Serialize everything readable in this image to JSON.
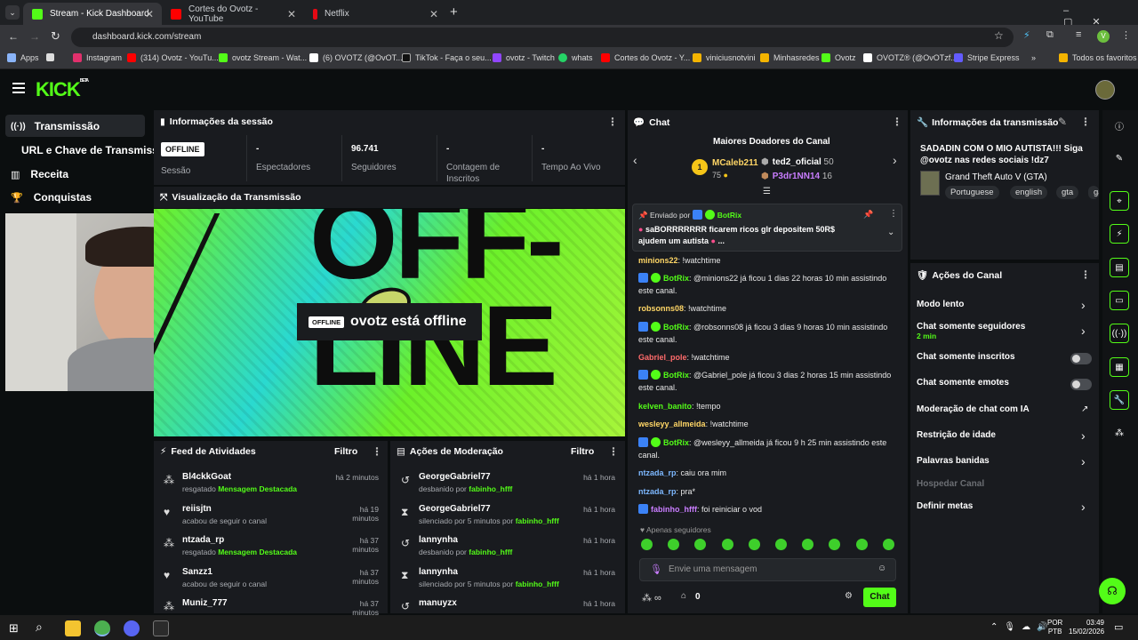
{
  "browser": {
    "tabs": [
      {
        "label": "Stream - Kick Dashboard",
        "active": true
      },
      {
        "label": "Cortes do Ovotz - YouTube",
        "active": false
      },
      {
        "label": "Netflix",
        "active": false
      }
    ],
    "url": "dashboard.kick.com/stream",
    "bookmarks": [
      "Apps",
      "Instagram",
      "(314) Ovotz - YouTu...",
      "ovotz Stream - Wat...",
      "(6) OVOTZ (@OvOT...",
      "TikTok - Faça o seu...",
      "ovotz - Twitch",
      "whats",
      "Cortes do Ovotz - Y...",
      "viniciusnotvini",
      "Minhasredes",
      "Ovotz",
      "OVOTZ® (@OvOTzf...",
      "Stripe Express"
    ],
    "all_favorites": "Todos os favoritos"
  },
  "sidebar": {
    "items": [
      "Transmissão",
      "URL e Chave de Transmissão",
      "Receita",
      "Conquistas"
    ]
  },
  "session": {
    "title": "Informações da sessão",
    "status_badge": "OFFLINE",
    "stats": [
      {
        "value": "",
        "label": "Sessão"
      },
      {
        "value": "-",
        "label": "Espectadores"
      },
      {
        "value": "96.741",
        "label": "Seguidores"
      },
      {
        "value": "-",
        "label": "Contagem de Inscritos"
      },
      {
        "value": "-",
        "label": "Tempo Ao Vivo"
      }
    ]
  },
  "preview": {
    "title": "Visualização da Transmissão",
    "offline_badge": "OFFLINE",
    "offline_text": "ovotz está offline"
  },
  "activity": {
    "title": "Feed de Atividades",
    "filter": "Filtro",
    "rows": [
      {
        "name": "Bl4ckkGoat",
        "sub": "resgatado",
        "hl": "Mensagem Destacada",
        "time": "há 2 minutos",
        "icon": "gift"
      },
      {
        "name": "reiisjtn",
        "sub": "acabou de seguir o canal",
        "hl": "",
        "time": "há 19 minutos",
        "icon": "heart"
      },
      {
        "name": "ntzada_rp",
        "sub": "resgatado",
        "hl": "Mensagem Destacada",
        "time": "há 37 minutos",
        "icon": "gift"
      },
      {
        "name": "Sanzz1",
        "sub": "acabou de seguir o canal",
        "hl": "",
        "time": "há 37 minutos",
        "icon": "heart"
      },
      {
        "name": "Muniz_777",
        "sub": "",
        "hl": "",
        "time": "há 37 minutos",
        "icon": "gift"
      }
    ]
  },
  "moderation": {
    "title": "Ações de Moderação",
    "filter": "Filtro",
    "rows": [
      {
        "name": "GeorgeGabriel77",
        "sub": "desbanido por",
        "by": "fabinho_hfff",
        "time": "há 1 hora",
        "icon": "undo"
      },
      {
        "name": "GeorgeGabriel77",
        "sub": "silenciado por 5 minutos por",
        "by": "fabinho_hfff",
        "time": "há 1 hora",
        "icon": "hourglass"
      },
      {
        "name": "lannynha",
        "sub": "desbanido por",
        "by": "fabinho_hfff",
        "time": "há 1 hora",
        "icon": "undo"
      },
      {
        "name": "lannynha",
        "sub": "silenciado por 5 minutos por",
        "by": "fabinho_hfff",
        "time": "há 1 hora",
        "icon": "hourglass"
      },
      {
        "name": "manuyzx",
        "sub": "",
        "by": "",
        "time": "há 1 hora",
        "icon": "undo"
      }
    ]
  },
  "chat": {
    "title": "Chat",
    "donors_title": "Maiores Doadores do Canal",
    "donors": [
      {
        "rank": "1",
        "name": "MCaleb211",
        "amount": "75"
      },
      {
        "name": "ted2_oficial",
        "amount": "50"
      },
      {
        "name": "P3dr1NN14",
        "amount": "16"
      }
    ],
    "pinned": {
      "by": "Enviado por",
      "user": "BotRix",
      "text": "saBORRRRRRR ficarem ricos glr depositem 50R$ ajudem um autista",
      "suffix": "..."
    },
    "messages": [
      {
        "user": "minions22",
        "color": "#ffd666",
        "text": ": !watchtime",
        "badges": false
      },
      {
        "user": "BotRix",
        "color": "#53fc18",
        "text": ": @minions22 já ficou 1 dias 22 horas 10 min assistindo este canal.",
        "badges": true
      },
      {
        "user": "robsonns08",
        "color": "#ffd666",
        "text": ": !watchtime",
        "badges": false
      },
      {
        "user": "BotRix",
        "color": "#53fc18",
        "text": ": @robsonns08 já ficou 3 dias 9 horas 10 min assistindo este canal.",
        "badges": true
      },
      {
        "user": "Gabriel_pole",
        "color": "#ff6b6b",
        "text": ": !watchtime",
        "badges": false
      },
      {
        "user": "BotRix",
        "color": "#53fc18",
        "text": ": @Gabriel_pole já ficou 3 dias 2 horas 15 min assistindo este canal.",
        "badges": true
      },
      {
        "user": "kelven_banito",
        "color": "#53fc18",
        "text": ": !tempo",
        "badges": false
      },
      {
        "user": "wesleyy_allmeida",
        "color": "#ffd666",
        "text": ": !watchtime",
        "badges": false
      },
      {
        "user": "BotRix",
        "color": "#53fc18",
        "text": ": @wesleyy_allmeida já ficou 9 h 25 min assistindo este canal.",
        "badges": true
      },
      {
        "user": "ntzada_rp",
        "color": "#7db8ff",
        "text": ": caiu ora mim",
        "badges": false
      },
      {
        "user": "ntzada_rp",
        "color": "#7db8ff",
        "text": ": pra*",
        "badges": false
      },
      {
        "user": "fabinho_hfff",
        "color": "#c97dff",
        "text": ": foi reiniciar o vod",
        "badges": true
      }
    ],
    "followers_only": "Apenas seguidores",
    "input_placeholder": "Envie uma mensagem",
    "count": "0",
    "send": "Chat"
  },
  "stream_info": {
    "title": "Informações da transmissão",
    "stream_title": "SADADIN COM O MIO AUTISTA!!! Siga @ovotz nas redes sociais !dz7",
    "category": "Grand Theft Auto V (GTA)",
    "tags": [
      "Portuguese",
      "english",
      "gta",
      "ga"
    ]
  },
  "channel_actions": {
    "title": "Ações do Canal",
    "items": [
      {
        "label": "Modo lento",
        "sub": "",
        "ctl": "chev"
      },
      {
        "label": "Chat somente seguidores",
        "sub": "2 min",
        "ctl": "chev"
      },
      {
        "label": "Chat somente inscritos",
        "sub": "",
        "ctl": "toggle"
      },
      {
        "label": "Chat somente emotes",
        "sub": "",
        "ctl": "toggle"
      },
      {
        "label": "Moderação de chat com IA",
        "sub": "",
        "ctl": "ext"
      },
      {
        "label": "Restrição de idade",
        "sub": "",
        "ctl": "chev"
      },
      {
        "label": "Palavras banidas",
        "sub": "",
        "ctl": "chev"
      },
      {
        "label": "Hospedar Canal",
        "sub": "",
        "ctl": "none"
      },
      {
        "label": "Definir metas",
        "sub": "",
        "ctl": "chev"
      }
    ]
  },
  "taskbar": {
    "lang1": "POR",
    "lang2": "PTB",
    "time": "03:49",
    "date": "15/02/2026"
  },
  "colors": {
    "kick_green": "#53fc18",
    "panel": "#191b1f",
    "bg": "#0b0e0f"
  }
}
